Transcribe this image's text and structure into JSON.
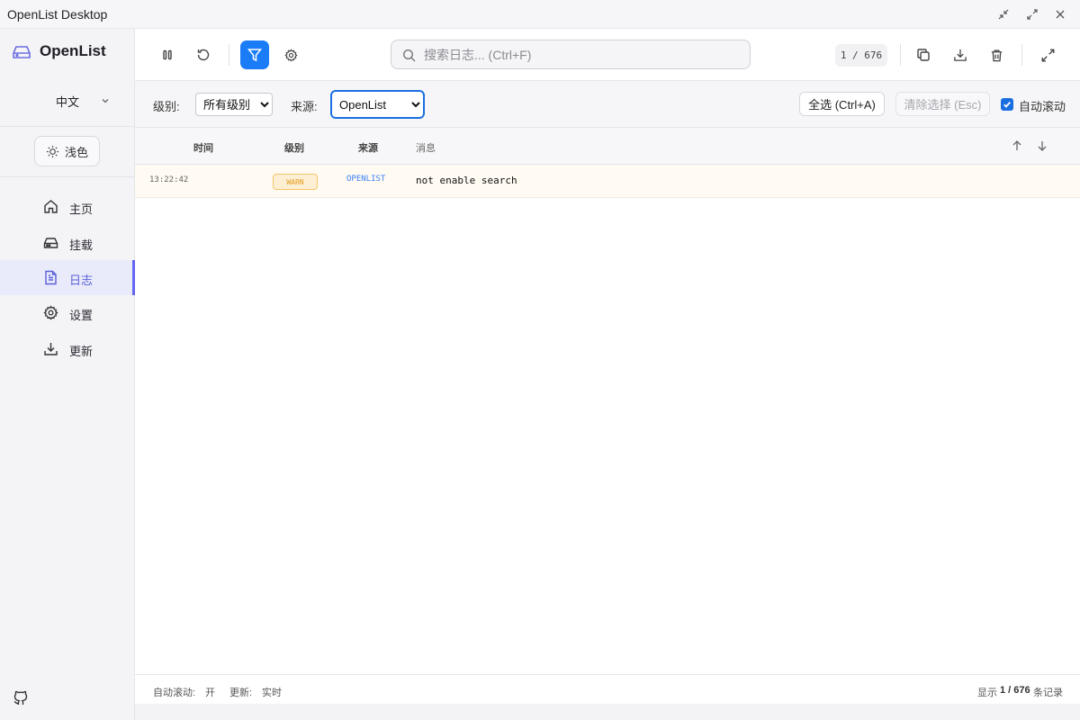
{
  "window": {
    "title": "OpenList Desktop"
  },
  "sidebar": {
    "brand": "OpenList",
    "language": "中文",
    "theme_label": "浅色",
    "items": [
      {
        "label": "主页",
        "icon": "home-icon",
        "active": false
      },
      {
        "label": "挂载",
        "icon": "hard-drive-icon",
        "active": false
      },
      {
        "label": "日志",
        "icon": "file-text-icon",
        "active": true
      },
      {
        "label": "设置",
        "icon": "gear-icon",
        "active": false
      },
      {
        "label": "更新",
        "icon": "download-icon",
        "active": false
      }
    ]
  },
  "toolbar": {
    "search_placeholder": "搜索日志... (Ctrl+F)",
    "search_value": "",
    "counter": "1 / 676"
  },
  "filters": {
    "level_label": "级别:",
    "level_value": "所有级别",
    "level_options": [
      "所有级别"
    ],
    "source_label": "来源:",
    "source_value": "OpenList",
    "source_options": [
      "OpenList"
    ],
    "select_all": "全选 (Ctrl+A)",
    "clear_selection": "清除选择 (Esc)",
    "auto_scroll_label": "自动滚动",
    "auto_scroll_checked": true
  },
  "table": {
    "columns": {
      "time": "时间",
      "level": "级别",
      "source": "来源",
      "message": "消息"
    },
    "rows": [
      {
        "time": "13:22:42",
        "level": "WARN",
        "source": "OPENLIST",
        "message": "not enable search"
      }
    ]
  },
  "status": {
    "auto_scroll_label": "自动滚动:",
    "auto_scroll_value": "开",
    "update_label": "更新:",
    "update_value": "实时",
    "display_prefix": "显示",
    "display_count": "1 / 676",
    "display_suffix": "条记录"
  },
  "colors": {
    "accent": "#1a7cf6",
    "nav_active": "#6366f1",
    "warn_text": "#e39a1f",
    "warn_bg": "#fdefd3",
    "source_text": "#3b82f6"
  }
}
